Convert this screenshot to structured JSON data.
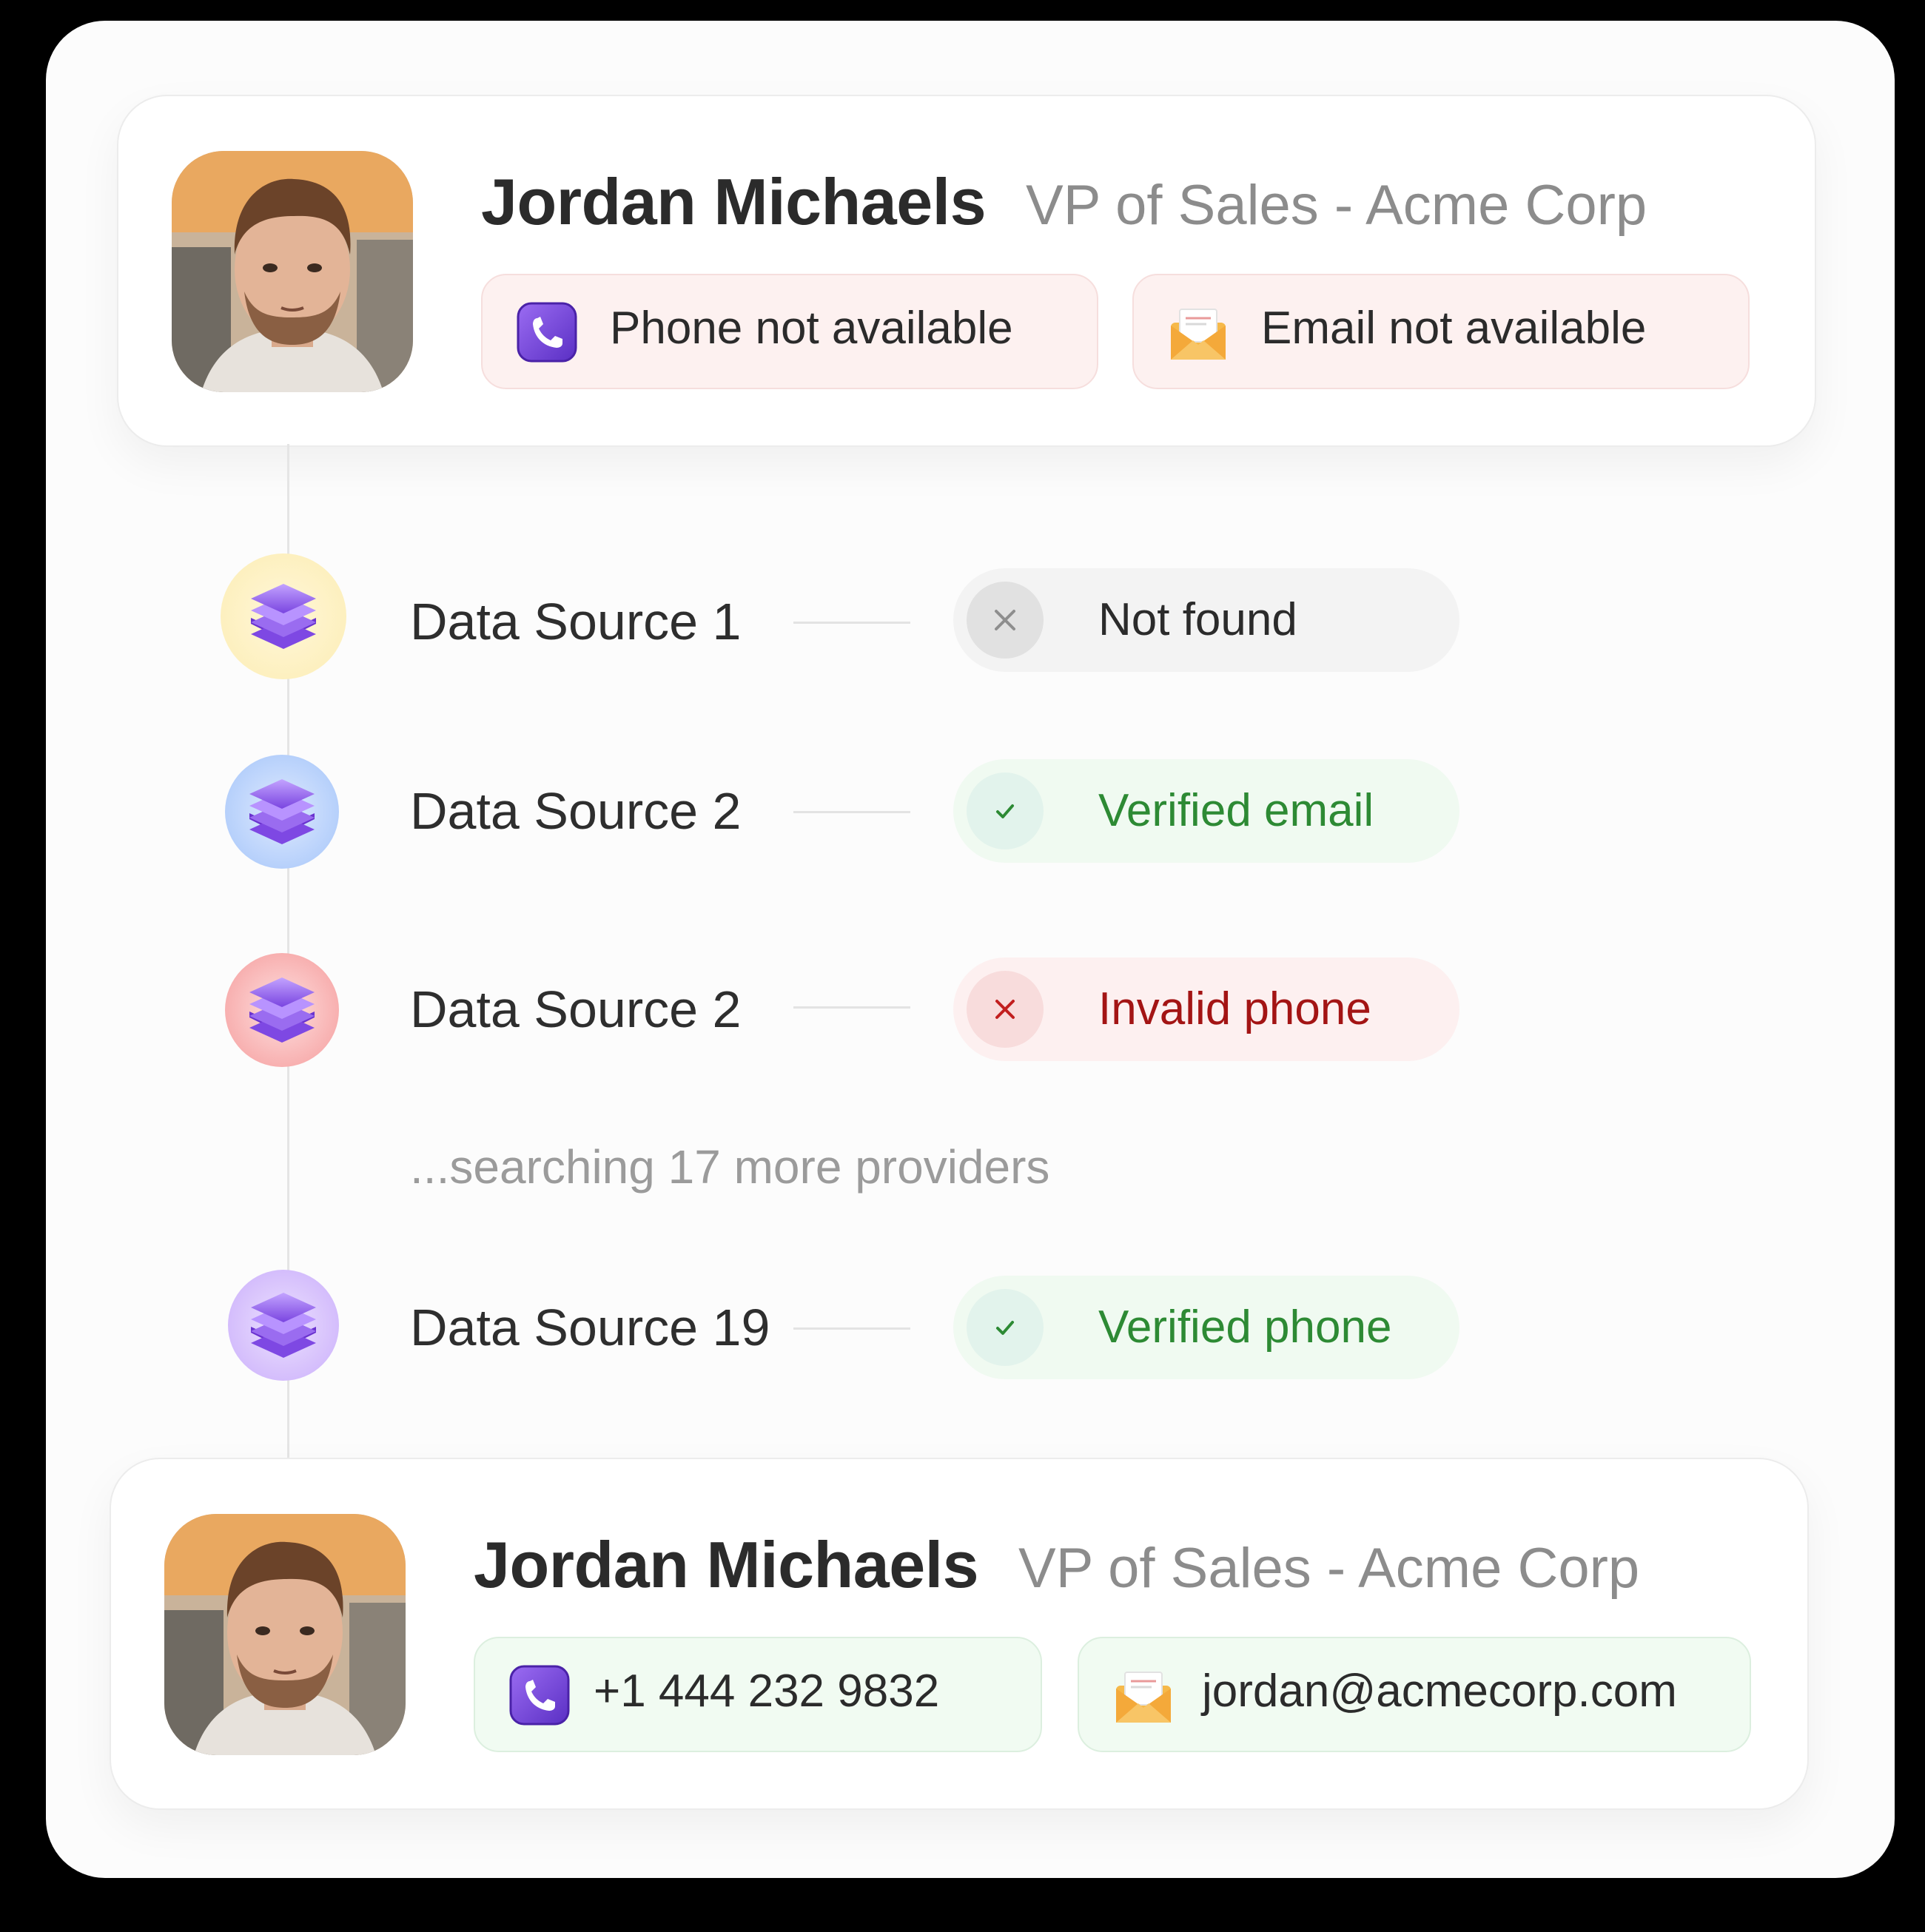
{
  "colors": {
    "verified_green": "#2d8a34",
    "invalid_red": "#a31414",
    "not_found_gray": "#2b2b2b",
    "accent_purple": "#7c4ddb"
  },
  "before_contact": {
    "name": "Jordan Michaels",
    "role": "VP of Sales - Acme Corp",
    "phone_text": "Phone not available",
    "email_text": "Email not available",
    "phone_icon": "phone-icon",
    "email_icon": "envelope-icon"
  },
  "sources": [
    {
      "label": "Data Source 1",
      "status": "Not found",
      "status_icon": "x-icon",
      "status_kind": "neutral"
    },
    {
      "label": "Data Source 2",
      "status": "Verified email",
      "status_icon": "check-icon",
      "status_kind": "success"
    },
    {
      "label": "Data Source 2",
      "status": "Invalid phone",
      "status_icon": "x-icon",
      "status_kind": "error"
    },
    {
      "label": "Data Source 19",
      "status": "Verified phone",
      "status_icon": "check-icon",
      "status_kind": "success"
    }
  ],
  "searching_text": "...searching 17 more providers",
  "after_contact": {
    "name": "Jordan Michaels",
    "role": "VP of Sales - Acme Corp",
    "phone_text": "+1 444 232 9832",
    "email_text": "jordan@acmecorp.com",
    "phone_icon": "phone-icon",
    "email_icon": "envelope-icon"
  }
}
